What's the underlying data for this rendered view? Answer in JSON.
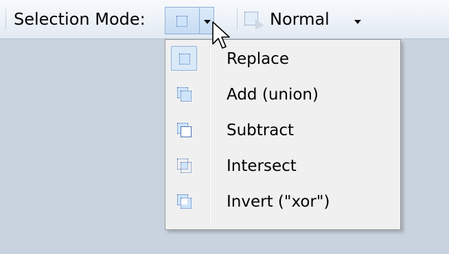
{
  "toolbar": {
    "selection_mode_label": "Selection Mode:",
    "selection_mode_current_icon": "replace-selection-icon",
    "blend_icon": "selection-blend-icon",
    "blend_mode_value": "Normal"
  },
  "menu": {
    "checked_item": "Replace",
    "items": [
      {
        "label": "Replace",
        "icon": "replace-selection-icon"
      },
      {
        "label": "Add (union)",
        "icon": "union-selection-icon"
      },
      {
        "label": "Subtract",
        "icon": "subtract-selection-icon"
      },
      {
        "label": "Intersect",
        "icon": "intersect-selection-icon"
      },
      {
        "label": "Invert (\"xor\")",
        "icon": "xor-selection-icon"
      }
    ]
  },
  "colors": {
    "toolbar_bg": "#edf2f8",
    "workspace_bg": "#c9d3df",
    "menu_bg": "#f0f0f0",
    "highlight_border": "#8ab3e2",
    "highlight_fill": "#dbeaf8",
    "selection_fill": "#cde4fa",
    "selection_outline": "#4a6fb1"
  }
}
